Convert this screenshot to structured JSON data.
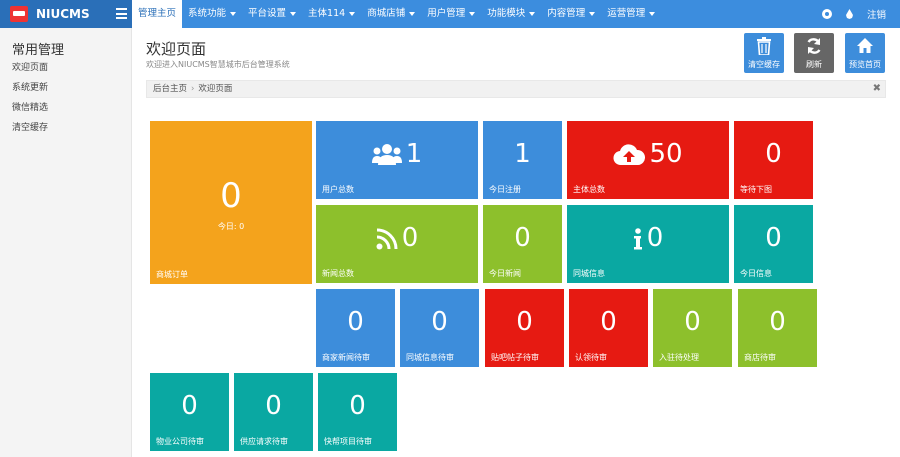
{
  "brand": {
    "name": "NIUCMS"
  },
  "nav": {
    "items": [
      {
        "label": "管理主页",
        "active": true,
        "dropdown": false
      },
      {
        "label": "系统功能",
        "active": false,
        "dropdown": true
      },
      {
        "label": "平台设置",
        "active": false,
        "dropdown": true
      },
      {
        "label": "主体114",
        "active": false,
        "dropdown": true
      },
      {
        "label": "商城店铺",
        "active": false,
        "dropdown": true
      },
      {
        "label": "用户管理",
        "active": false,
        "dropdown": true
      },
      {
        "label": "功能模块",
        "active": false,
        "dropdown": true
      },
      {
        "label": "内容管理",
        "active": false,
        "dropdown": true
      },
      {
        "label": "运营管理",
        "active": false,
        "dropdown": true
      }
    ],
    "logout": "注销"
  },
  "sidebar": {
    "title": "常用管理",
    "items": [
      "欢迎页面",
      "系统更新",
      "微信精选",
      "清空缓存"
    ]
  },
  "page": {
    "title": "欢迎页面",
    "subtitle": "欢迎进入NIUCMS智慧城市后台管理系统"
  },
  "toolbar": {
    "clear_cache": "清空缓存",
    "refresh": "刷新",
    "preview": "预览首页"
  },
  "breadcrumb": {
    "home": "后台主页",
    "current": "欢迎页面",
    "close": "✖"
  },
  "tiles": {
    "orders": {
      "value": "0",
      "today": "今日: 0",
      "label": "商城订单"
    },
    "users": {
      "value": "1",
      "label": "用户总数"
    },
    "today_reg": {
      "value": "1",
      "label": "今日注册"
    },
    "subjects": {
      "value": "50",
      "label": "主体总数"
    },
    "pending_img": {
      "value": "0",
      "label": "等待下图"
    },
    "news": {
      "value": "0",
      "label": "新闻总数"
    },
    "today_news": {
      "value": "0",
      "label": "今日新闻"
    },
    "city_info": {
      "value": "0",
      "label": "同城信息"
    },
    "today_info": {
      "value": "0",
      "label": "今日信息"
    },
    "merchant_news": {
      "value": "0",
      "label": "商家新闻待审"
    },
    "city_info_pending": {
      "value": "0",
      "label": "同城信息待审"
    },
    "posts_pending": {
      "value": "0",
      "label": "贴吧帖子待审"
    },
    "claim_pending": {
      "value": "0",
      "label": "认领待审"
    },
    "join_pending": {
      "value": "0",
      "label": "入驻待处理"
    },
    "shop_pending": {
      "value": "0",
      "label": "商店待审"
    },
    "property_pending": {
      "value": "0",
      "label": "物业公司待审"
    },
    "supply_pending": {
      "value": "0",
      "label": "供应请求待审"
    },
    "express_pending": {
      "value": "0",
      "label": "快帮项目待审"
    }
  }
}
